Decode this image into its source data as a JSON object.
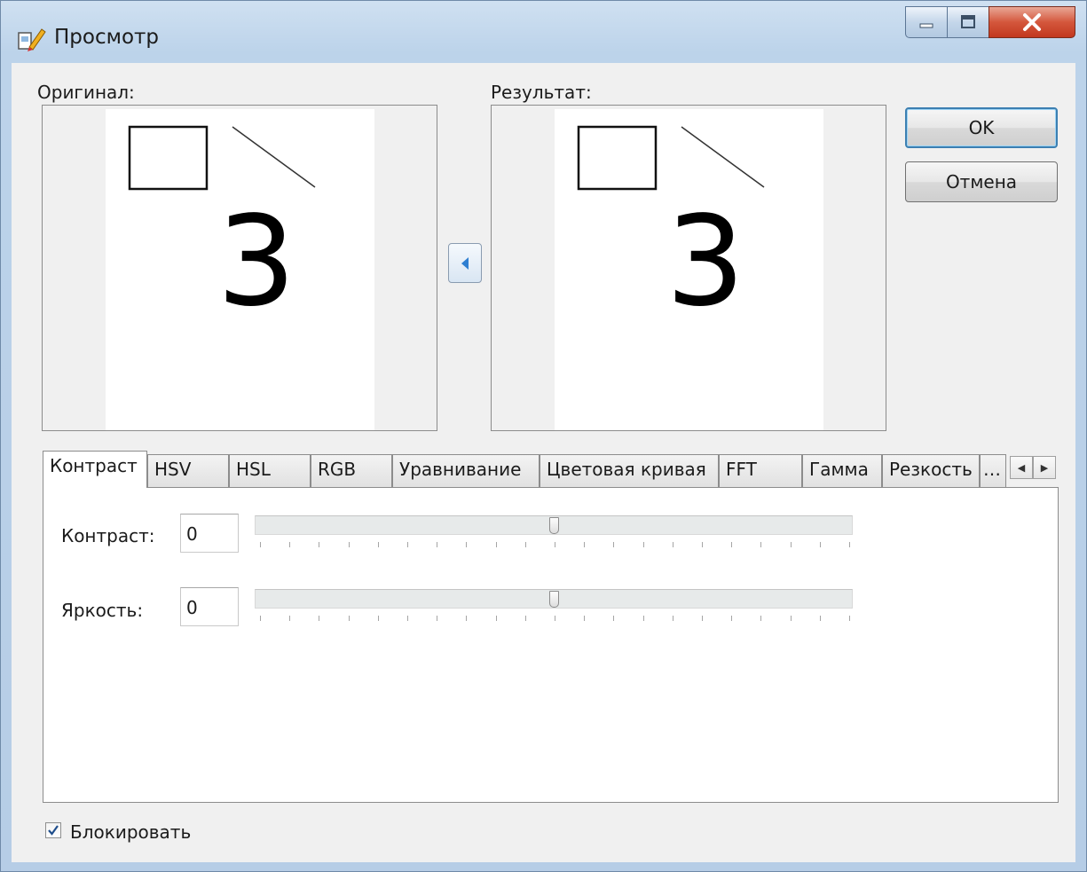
{
  "window": {
    "title": "Просмотр",
    "icon": "app-icon",
    "controls": {
      "minimize": "minimize-icon",
      "maximize": "maximize-icon",
      "close": "close-icon"
    }
  },
  "preview": {
    "original_label": "Оригинал:",
    "result_label": "Результат:",
    "digit": "3"
  },
  "buttons": {
    "ok": "OK",
    "cancel": "Отмена"
  },
  "tabs": [
    "Контраст",
    "HSV",
    "HSL",
    "RGB",
    "Уравнивание",
    "Цветовая кривая",
    "FFT",
    "Гамма",
    "Резкость"
  ],
  "active_tab": "Контраст",
  "contrast": {
    "label": "Контраст:",
    "value": "0",
    "slider_position": 0.5
  },
  "brightness": {
    "label": "Яркость:",
    "value": "0",
    "slider_position": 0.5
  },
  "lock": {
    "label": "Блокировать",
    "checked": true
  },
  "colors": {
    "title_close": "#c2381f",
    "accent": "#3c7fb1",
    "arrow": "#2f7fd1"
  }
}
